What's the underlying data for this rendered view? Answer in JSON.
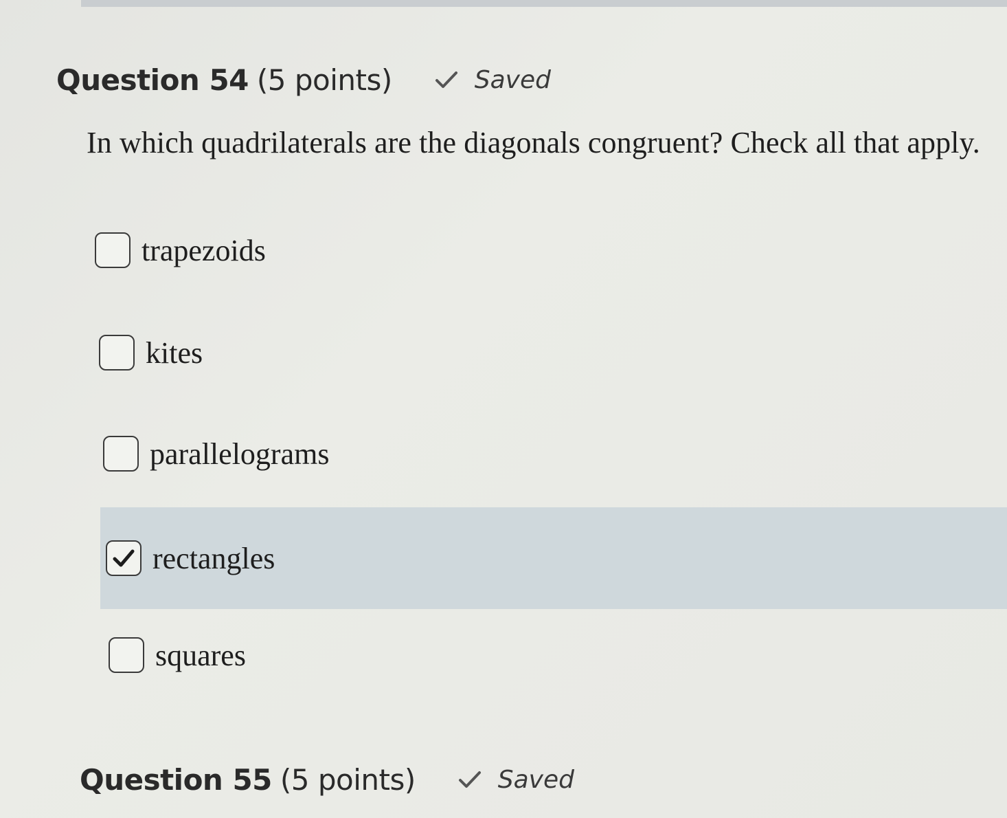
{
  "questions": [
    {
      "title": "Question 54",
      "points": "(5 points)",
      "status": "Saved",
      "prompt": "In which quadrilaterals are the diagonals congruent? Check all that apply.",
      "options": [
        {
          "label": "trapezoids",
          "checked": false
        },
        {
          "label": "kites",
          "checked": false
        },
        {
          "label": "parallelograms",
          "checked": false
        },
        {
          "label": "rectangles",
          "checked": true
        },
        {
          "label": "squares",
          "checked": false
        }
      ]
    },
    {
      "title": "Question 55",
      "points": "(5 points)",
      "status": "Saved"
    }
  ],
  "icons": {
    "status": "checkmark-icon",
    "selected": "checkmark-icon"
  },
  "colors": {
    "selected_row": "#cfd8dc",
    "text": "#1e1e1e"
  }
}
